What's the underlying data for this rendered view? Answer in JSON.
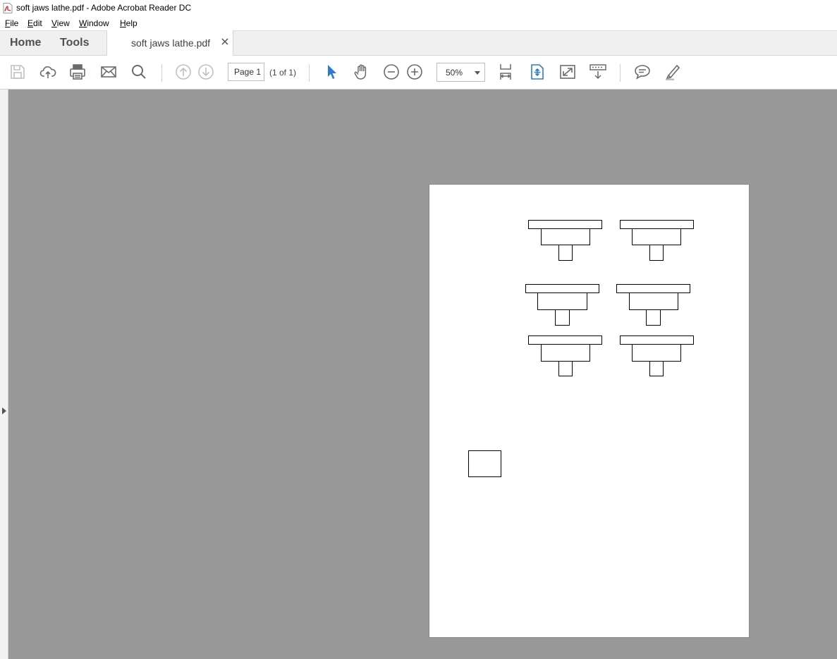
{
  "window": {
    "title": "soft jaws lathe.pdf - Adobe Acrobat Reader DC"
  },
  "menu": [
    {
      "label": "File",
      "mnemonic": "F",
      "rest": "ile"
    },
    {
      "label": "Edit",
      "mnemonic": "E",
      "rest": "dit"
    },
    {
      "label": "View",
      "mnemonic": "V",
      "rest": "iew"
    },
    {
      "label": "Window",
      "mnemonic": "W",
      "rest": "indow"
    },
    {
      "label": "Help",
      "mnemonic": "H",
      "rest": "elp"
    }
  ],
  "nav": {
    "home": "Home",
    "tools": "Tools",
    "tab_label": "soft jaws lathe.pdf"
  },
  "toolbar": {
    "icons": [
      "save-icon",
      "cloud-upload-icon",
      "print-icon",
      "email-icon",
      "search-icon",
      "previous-page-icon",
      "next-page-icon",
      "select-tool-icon",
      "hand-tool-icon",
      "zoom-out-icon",
      "zoom-in-icon",
      "fit-page-icon",
      "fit-width-scroll-icon",
      "full-screen-icon",
      "read-mode-icon",
      "comment-icon",
      "highlight-icon"
    ],
    "page_value": "Page 1",
    "page_of": "(1 of 1)",
    "zoom": "50%"
  },
  "colors": {
    "accent": "#2d7bd1",
    "canvas": "#999999",
    "icon": "#6b6b6b",
    "icon_disabled": "#c0c0c0",
    "pdf_red": "#d4272e"
  }
}
